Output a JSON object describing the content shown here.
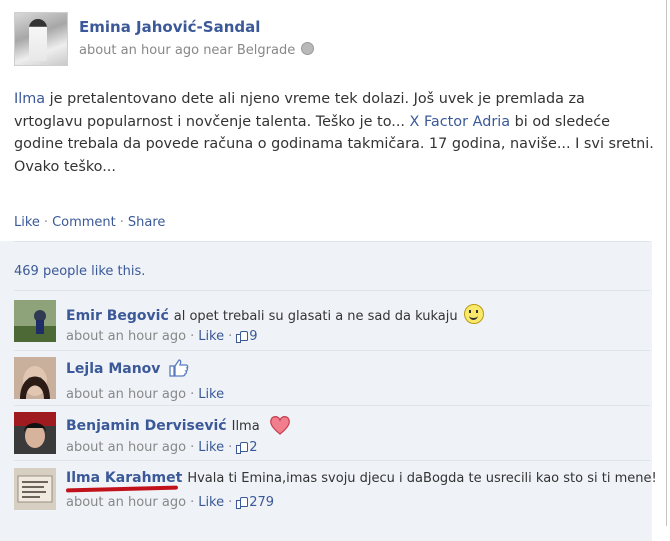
{
  "post": {
    "author": "Emina Jahović-Sandal",
    "meta": "about an hour ago near Belgrade",
    "story": {
      "link1": "Ilma",
      "part1": " je pretalentovano dete ali njeno vreme tek dolazi. Još uvek je premlada za vrtoglavu popularnost i novčenje talenta. Teško je to... ",
      "link2": "X Factor Adria",
      "part2": " bi od sledeće godine trebala da povede računa o godinama takmičara. 17 godina, naviše... I svi sretni. Ovako teško..."
    },
    "actions": {
      "like": "Like",
      "comment": "Comment",
      "share": "Share"
    },
    "likes_text": "469 people like this."
  },
  "comments": [
    {
      "name": "Emir Begović",
      "text": "al opet trebali su glasati a ne sad da kukaju",
      "time": "about an hour ago",
      "like": "Like",
      "count": "9"
    },
    {
      "name": "Lejla Manov",
      "text": "",
      "time": "about an hour ago",
      "like": "Like",
      "count": ""
    },
    {
      "name": "Benjamin Dervisević",
      "text": "Ilma",
      "time": "about an hour ago",
      "like": "Like",
      "count": "2"
    },
    {
      "name": "Ilma Karahmet",
      "text": "Hvala ti Emina,imas svoju djecu i daBogda te usrecili kao sto si ti mene!",
      "time": "about an hour ago",
      "like": "Like",
      "count": "279"
    }
  ],
  "colors": {
    "link": "#3b5998",
    "feed_bg": "#eff2f7",
    "underline": "#c1121c"
  },
  "icons": [
    "globe-icon",
    "thumbs-up-icon",
    "smiley-icon",
    "heart-icon"
  ]
}
